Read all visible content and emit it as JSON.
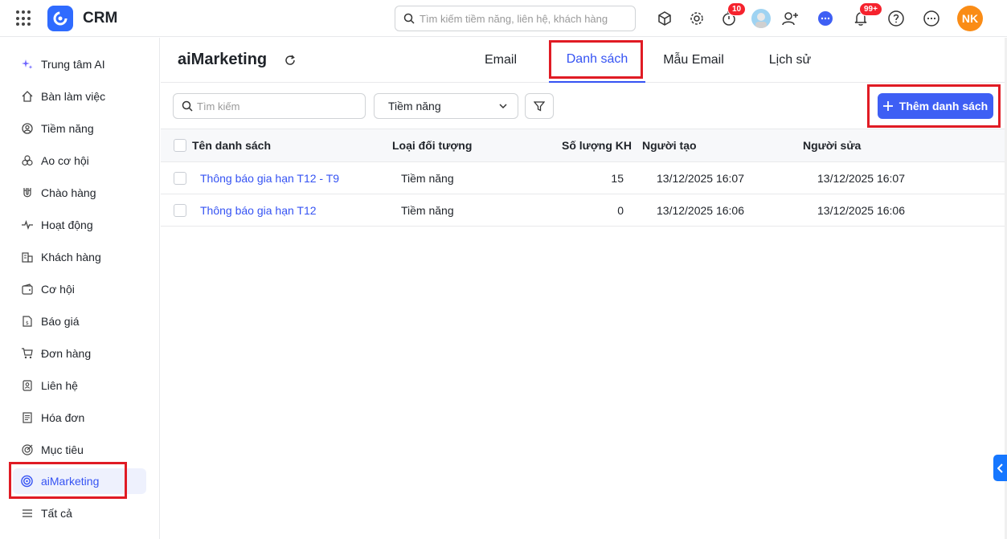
{
  "app": {
    "title": "CRM"
  },
  "topbar": {
    "search_placeholder": "Tìm kiếm tiềm năng, liên hệ, khách hàng",
    "timer_badge": "10",
    "notification_badge": "99+",
    "user_initials": "NK"
  },
  "sidebar": {
    "items": [
      {
        "label": "Trung tâm AI",
        "icon": "sparkle-icon"
      },
      {
        "label": "Bàn làm việc",
        "icon": "home-icon"
      },
      {
        "label": "Tiềm năng",
        "icon": "target-user-icon"
      },
      {
        "label": "Ao cơ hội",
        "icon": "pool-icon"
      },
      {
        "label": "Chào hàng",
        "icon": "magnet-icon"
      },
      {
        "label": "Hoạt động",
        "icon": "activity-icon"
      },
      {
        "label": "Khách hàng",
        "icon": "building-icon"
      },
      {
        "label": "Cơ hội",
        "icon": "wallet-icon"
      },
      {
        "label": "Báo giá",
        "icon": "quote-icon"
      },
      {
        "label": "Đơn hàng",
        "icon": "cart-icon"
      },
      {
        "label": "Liên hệ",
        "icon": "contact-icon"
      },
      {
        "label": "Hóa đơn",
        "icon": "invoice-icon"
      },
      {
        "label": "Mục tiêu",
        "icon": "goal-icon"
      },
      {
        "label": "aiMarketing",
        "icon": "marketing-icon",
        "active": true
      },
      {
        "label": "Tất cả",
        "icon": "menu-icon"
      }
    ]
  },
  "page": {
    "title": "aiMarketing",
    "tabs": [
      {
        "label": "Email"
      },
      {
        "label": "Danh sách",
        "active": true
      },
      {
        "label": "Mẫu Email"
      },
      {
        "label": "Lịch sử"
      }
    ]
  },
  "filters": {
    "search_placeholder": "Tìm kiếm",
    "object_type_selected": "Tiềm năng",
    "add_button_label": "Thêm danh sách"
  },
  "table": {
    "columns": [
      "Tên danh sách",
      "Loại đối tượng",
      "Số lượng KH",
      "Người tạo",
      "Người sửa"
    ],
    "rows": [
      {
        "name": "Thông báo gia hạn T12 - T9",
        "type": "Tiềm năng",
        "count": "15",
        "created": "13/12/2025 16:07",
        "modified": "13/12/2025 16:07"
      },
      {
        "name": "Thông báo gia hạn T12",
        "type": "Tiềm năng",
        "count": "0",
        "created": "13/12/2025 16:06",
        "modified": "13/12/2025 16:06"
      }
    ]
  },
  "colors": {
    "accent": "#3553f3",
    "highlight": "#e01b24",
    "brand": "#2f6bff",
    "avatar": "#fa8c16"
  }
}
